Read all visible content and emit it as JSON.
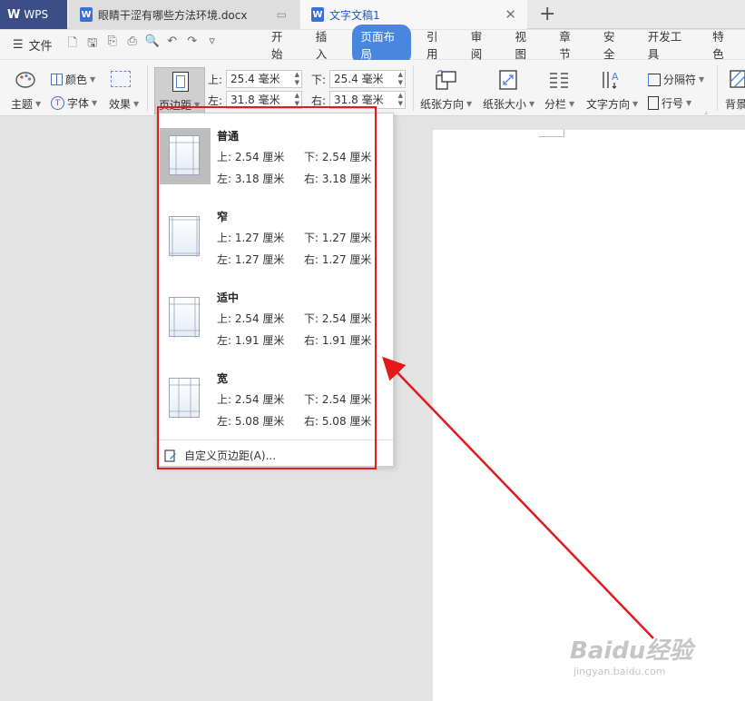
{
  "titlebar": {
    "app_tab": "WPS",
    "tabs": [
      {
        "label": "眼睛干涩有哪些方法环境.docx"
      },
      {
        "label": "文字文稿1"
      }
    ]
  },
  "menubar": {
    "file_label": "文件",
    "items": [
      "开始",
      "插入",
      "页面布局",
      "引用",
      "审阅",
      "视图",
      "章节",
      "安全",
      "开发工具",
      "特色"
    ],
    "active": "页面布局"
  },
  "ribbon": {
    "theme": "主题",
    "color": "颜色",
    "font": "字体",
    "effect": "效果",
    "margins": "页边距",
    "top_label": "上:",
    "top_value": "25.4 毫米",
    "bottom_label": "下:",
    "bottom_value": "25.4 毫米",
    "left_label": "左:",
    "left_value": "31.8 毫米",
    "right_label": "右:",
    "right_value": "31.8 毫米",
    "orientation": "纸张方向",
    "size": "纸张大小",
    "columns": "分栏",
    "text_direction": "文字方向",
    "breaks": "分隔符",
    "line_numbers": "行号",
    "background": "背景"
  },
  "margin_presets": [
    {
      "name": "普通",
      "top": "上: 2.54 厘米",
      "bottom": "下: 2.54 厘米",
      "left": "左: 3.18 厘米",
      "right": "右: 3.18 厘米"
    },
    {
      "name": "窄",
      "top": "上: 1.27 厘米",
      "bottom": "下: 1.27 厘米",
      "left": "左: 1.27 厘米",
      "right": "右: 1.27 厘米"
    },
    {
      "name": "适中",
      "top": "上: 2.54 厘米",
      "bottom": "下: 2.54 厘米",
      "left": "左: 1.91 厘米",
      "right": "右: 1.91 厘米"
    },
    {
      "name": "宽",
      "top": "上: 2.54 厘米",
      "bottom": "下: 2.54 厘米",
      "left": "左: 5.08 厘米",
      "right": "右: 5.08 厘米"
    }
  ],
  "custom_margins": "自定义页边距(A)...",
  "watermark": {
    "line1": "Baidu经验",
    "line2": "jingyan.baidu.com"
  },
  "colors": {
    "accent": "#4a86e0",
    "wps_tab": "#3b4f86",
    "annotation_red": "#e3191c"
  }
}
